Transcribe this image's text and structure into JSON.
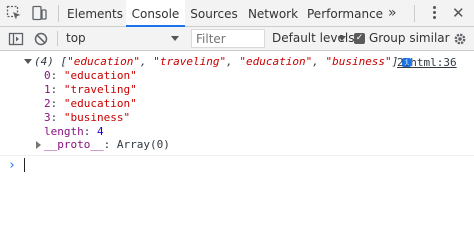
{
  "tabs": [
    {
      "label": "Elements"
    },
    {
      "label": "Console"
    },
    {
      "label": "Sources"
    },
    {
      "label": "Network"
    },
    {
      "label": "Performance"
    }
  ],
  "overflow_glyph": "»",
  "toolbar": {
    "context": "top",
    "filter_placeholder": "Filter",
    "levels": "Default levels",
    "group_similar": "Group similar"
  },
  "log": {
    "header_count": "(4)",
    "header_items": [
      "\"education\"",
      "\"traveling\"",
      "\"education\"",
      "\"business\""
    ],
    "source": "2.html:36",
    "entries": [
      {
        "key": "0",
        "value": "\"education\""
      },
      {
        "key": "1",
        "value": "\"traveling\""
      },
      {
        "key": "2",
        "value": "\"education\""
      },
      {
        "key": "3",
        "value": "\"business\""
      }
    ],
    "length_key": "length",
    "length_value": "4",
    "proto_key": "__proto__",
    "proto_value": "Array(0)"
  },
  "colors": {
    "accent": "#1a73e8",
    "string": "#c80000",
    "property_key": "#881280",
    "number": "#1c00cf"
  }
}
